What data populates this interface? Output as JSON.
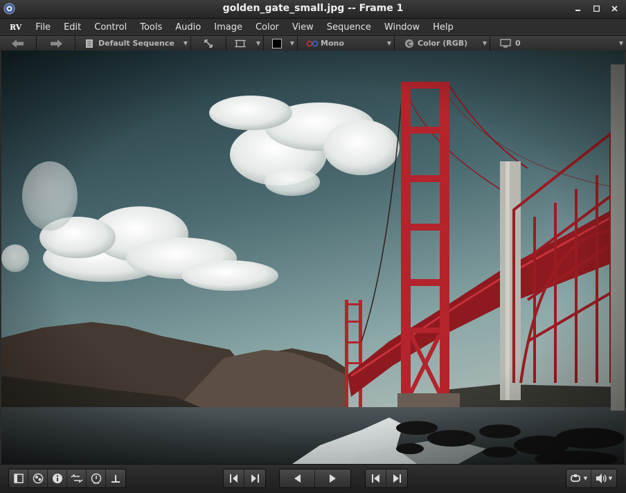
{
  "window": {
    "title": "golden_gate_small.jpg -- Frame 1",
    "controls": [
      "close-icon",
      "minimize-icon",
      "maximize-icon"
    ]
  },
  "menubar": {
    "logo": "RV",
    "items": [
      "File",
      "Edit",
      "Control",
      "Tools",
      "Audio",
      "Image",
      "Color",
      "View",
      "Sequence",
      "Window",
      "Help"
    ]
  },
  "toolbar": {
    "sequence_label": "Default Sequence",
    "stereo_label": "Mono",
    "color_label": "Color (RGB)",
    "display_label": "0"
  },
  "colors": {
    "titlebar": "#2e2e2e",
    "background": "#2b2b2b",
    "bridge_red": "#b0202a",
    "sky": "#5e7c80"
  },
  "image": {
    "description_icon": "golden-gate-bridge-photo"
  }
}
